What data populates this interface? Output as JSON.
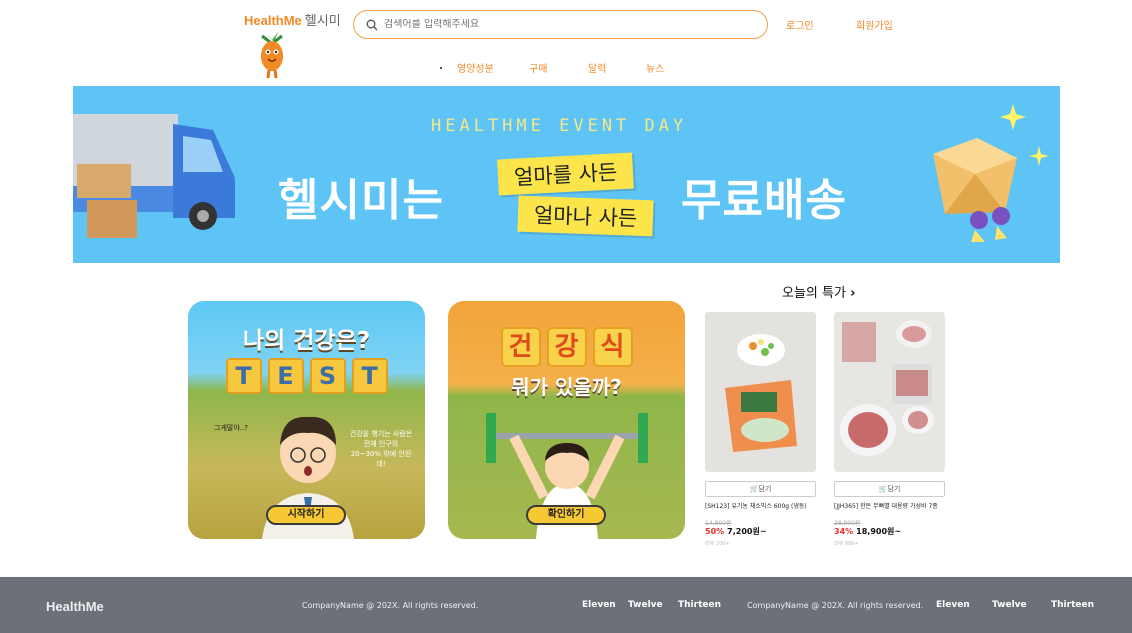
{
  "header": {
    "brand": "HealthMe",
    "brand_kor": "헬시미",
    "search_placeholder": "검색어를 입력해주세요",
    "login": "로그인",
    "signup": "회원가입"
  },
  "nav": [
    "영양성분",
    "구매",
    "달력",
    "뉴스"
  ],
  "banner": {
    "event": "HEALTHME EVENT DAY",
    "left_text": "헬시미는",
    "tag1": "얼마를 사든",
    "tag2": "얼마나 사든",
    "right_text": "무료배송"
  },
  "cards": [
    {
      "title": "나의 건강은?",
      "tiles": [
        "T",
        "E",
        "S",
        "T"
      ],
      "caption_left": "그게말야..?",
      "caption_right": "건강을 챙기는 사람은 전체 인구의 20~30% 밖에 안된데!",
      "button": "시작하기"
    },
    {
      "tiles": [
        "건",
        "강",
        "식"
      ],
      "subtitle": "뭐가 있을까?",
      "button": "확인하기"
    }
  ],
  "deals": {
    "title": "오늘의 특가",
    "cart_label": "담기",
    "products": [
      {
        "name": "[SH123] 유기농 채소믹스 600g (냉동)",
        "orig": "14,800원",
        "discount": "50%",
        "price": "7,200원~",
        "review": "리뷰 200+"
      },
      {
        "name": "[JJH365] 한돈 무뼈별 대용량 가성비 7종",
        "orig": "28,900원",
        "discount": "34%",
        "price": "18,900원~",
        "review": "리뷰 999+"
      }
    ]
  },
  "footer": {
    "brand": "HealthMe",
    "copyright": "CompanyName @ 202X. All rights reserved.",
    "links1": [
      "Eleven",
      "Twelve",
      "Thirteen"
    ],
    "copyright2": "CompanyName @ 202X. All rights reserved.",
    "links2": [
      "Eleven",
      "Twelve",
      "Thirteen"
    ]
  },
  "colors": {
    "accent": "#f08a24",
    "banner": "#5ec3f5",
    "footer": "#6b7079",
    "discount": "#e8302a"
  }
}
